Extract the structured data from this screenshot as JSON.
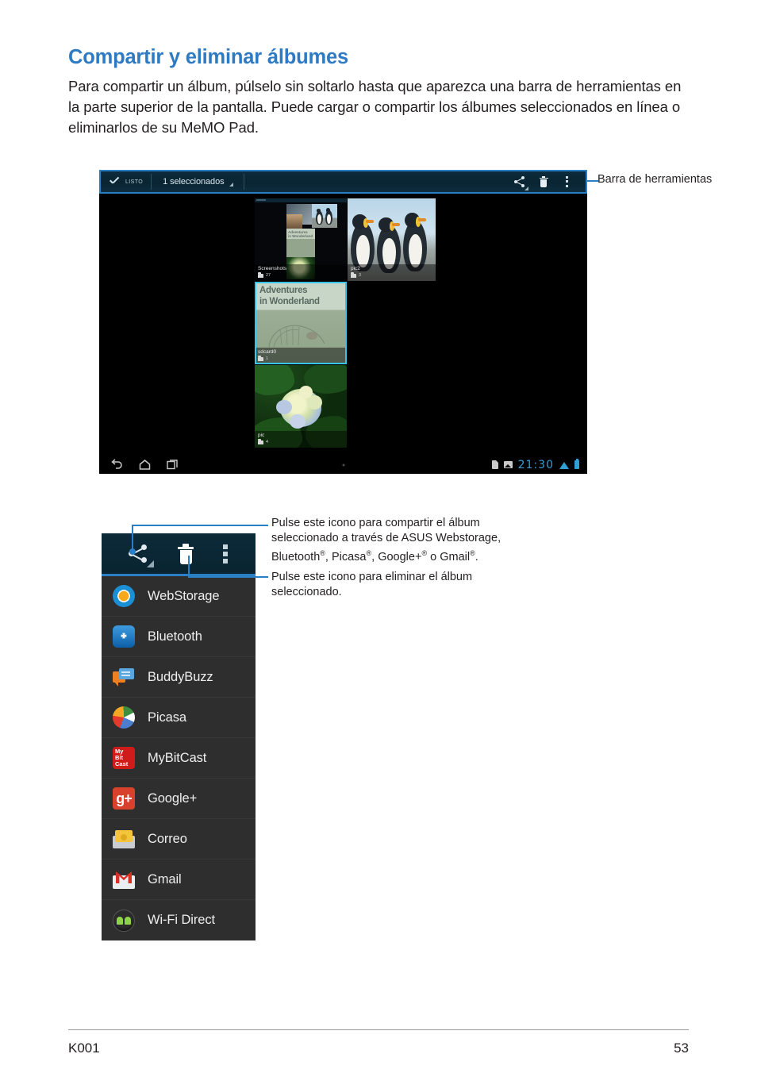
{
  "heading": "Compartir y eliminar álbumes",
  "intro": "Para compartir un álbum, púlselo sin soltarlo hasta que aparezca una barra de herramientas en la parte superior de la pantalla. Puede cargar o compartir los álbumes seleccionados en línea o eliminarlos de su MeMO Pad.",
  "colors": {
    "heading_blue": "#2e7bc4",
    "callout_blue": "#2b7fc4",
    "toolbar_navy": "#0a2431",
    "selection_cyan": "#38c5e8",
    "status_blue": "#2f9fd6"
  },
  "tablet": {
    "toolbar": {
      "done_label": "LISTO",
      "selection_count": "1 seleccionados",
      "icons": [
        "share-icon",
        "trash-icon",
        "overflow-menu-icon"
      ]
    },
    "albums": [
      {
        "name": "Screenshots",
        "count": "27",
        "selected": false
      },
      {
        "name": "pic2",
        "count": "3",
        "selected": false
      },
      {
        "name": "sdcard0",
        "count": "1",
        "selected": true
      },
      {
        "name": "pic",
        "count": "4",
        "selected": false
      }
    ],
    "album_cover_text": {
      "wonderland_line1": "Adventures",
      "wonderland_line2": "in Wonderland"
    },
    "navbar": {
      "back": "back-icon",
      "home": "home-icon",
      "recents": "recent-apps-icon"
    },
    "statusbar": {
      "time": "21:30",
      "icons": [
        "sd-card-icon",
        "screenshot-icon",
        "wifi-icon",
        "battery-icon"
      ]
    }
  },
  "callouts": {
    "toolbar": "Barra de herramientas",
    "share": "Pulse este icono para compartir el álbum seleccionado a través de ASUS Webstorage, Bluetooth®, Picasa®, Google+® o Gmail®.",
    "delete": "Pulse este icono para eliminar el álbum seleccionado."
  },
  "share_panel": {
    "toolbar_icons": [
      "share-icon",
      "trash-icon",
      "overflow-menu-icon"
    ],
    "items": [
      {
        "label": "WebStorage",
        "icon": "webstorage-icon"
      },
      {
        "label": "Bluetooth",
        "icon": "bluetooth-icon"
      },
      {
        "label": "BuddyBuzz",
        "icon": "buddybuzz-icon"
      },
      {
        "label": "Picasa",
        "icon": "picasa-icon"
      },
      {
        "label": "MyBitCast",
        "icon": "mybitcast-icon"
      },
      {
        "label": "Google+",
        "icon": "google-plus-icon"
      },
      {
        "label": "Correo",
        "icon": "email-icon"
      },
      {
        "label": "Gmail",
        "icon": "gmail-icon"
      },
      {
        "label": "Wi-Fi Direct",
        "icon": "wifi-direct-icon"
      }
    ],
    "mybitcast_lines": {
      "l1": "My",
      "l2": "Bit",
      "l3": "Cast"
    },
    "bluetooth_glyph": "᛭",
    "google_plus_glyph": "g+"
  },
  "footer": {
    "left": "K001",
    "right": "53"
  }
}
